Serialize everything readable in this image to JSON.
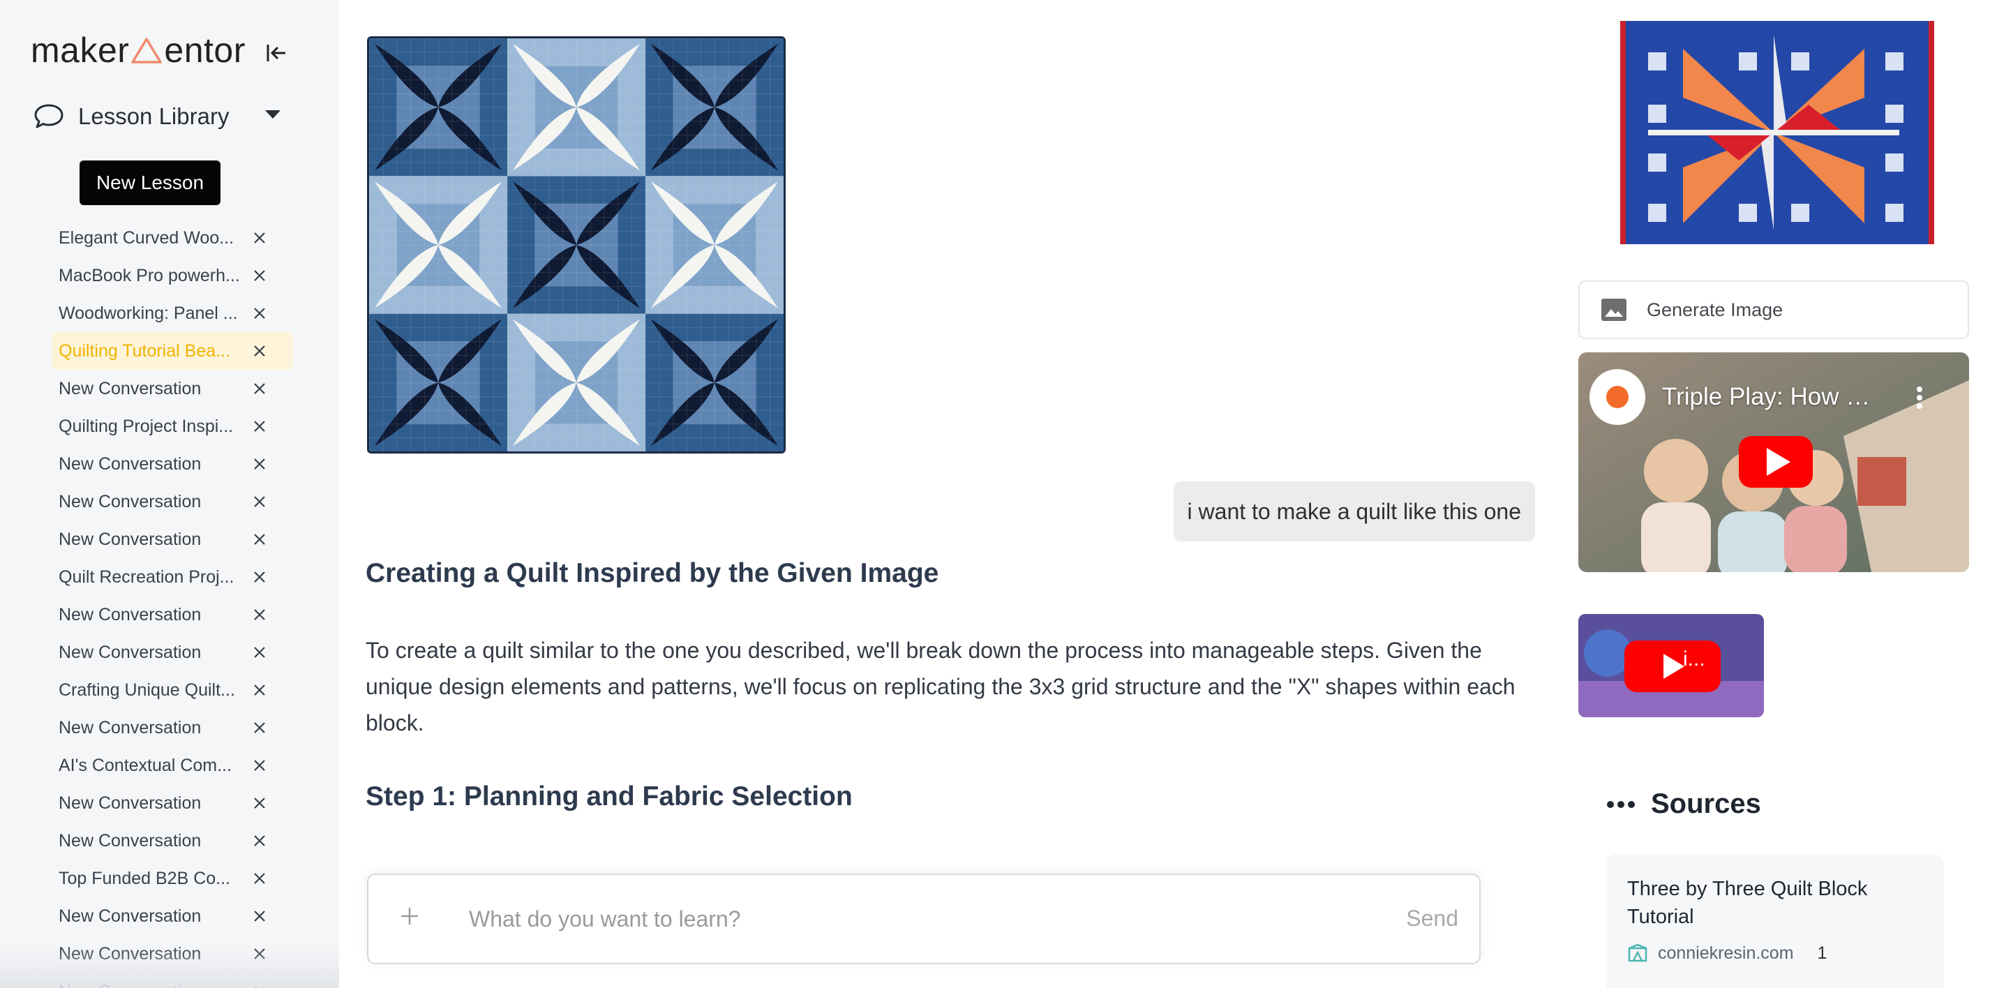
{
  "app": {
    "logo_left": "maker",
    "logo_right": "entor",
    "brand_accent": "#f08a6b"
  },
  "sidebar": {
    "library_label": "Lesson Library",
    "new_lesson_label": "New Lesson",
    "lessons": [
      {
        "title": "Elegant Curved Woo...",
        "active": false
      },
      {
        "title": "MacBook Pro powerh...",
        "active": false
      },
      {
        "title": "Woodworking: Panel ...",
        "active": false
      },
      {
        "title": "Quilting Tutorial Bea...",
        "active": true
      },
      {
        "title": "New Conversation",
        "active": false
      },
      {
        "title": "Quilting Project Inspi...",
        "active": false
      },
      {
        "title": "New Conversation",
        "active": false
      },
      {
        "title": "New Conversation",
        "active": false
      },
      {
        "title": "New Conversation",
        "active": false
      },
      {
        "title": "Quilt Recreation Proj...",
        "active": false
      },
      {
        "title": "New Conversation",
        "active": false
      },
      {
        "title": "New Conversation",
        "active": false
      },
      {
        "title": "Crafting Unique Quilt...",
        "active": false
      },
      {
        "title": "New Conversation",
        "active": false
      },
      {
        "title": "AI's Contextual Com...",
        "active": false
      },
      {
        "title": "New Conversation",
        "active": false
      },
      {
        "title": "New Conversation",
        "active": false
      },
      {
        "title": "Top Funded B2B Co...",
        "active": false
      },
      {
        "title": "New Conversation",
        "active": false
      },
      {
        "title": "New Conversation",
        "active": false
      },
      {
        "title": "New Conversation",
        "active": false
      }
    ],
    "active_color": "#f1b400"
  },
  "chat": {
    "user_message": "i want to make a quilt like this one",
    "heading": "Creating a Quilt Inspired by the Given Image",
    "paragraph": "To create a quilt similar to the one you described, we'll break down the process into manageable steps. Given the unique design elements and patterns, we'll focus on replicating the 3x3 grid structure and the \"X\" shapes within each block.",
    "step_heading": "Step 1: Planning and Fabric Selection"
  },
  "composer": {
    "placeholder": "What do you want to learn?",
    "send_label": "Send"
  },
  "media": {
    "generate_image_label": "Generate Image",
    "video_main_title": "Triple Play: How t...",
    "video_small_title": "i..."
  },
  "sources": {
    "heading": "Sources",
    "items": [
      {
        "title": "Three by Three Quilt Block Tutorial",
        "site": "conniekresin.com",
        "count": "1"
      }
    ]
  }
}
